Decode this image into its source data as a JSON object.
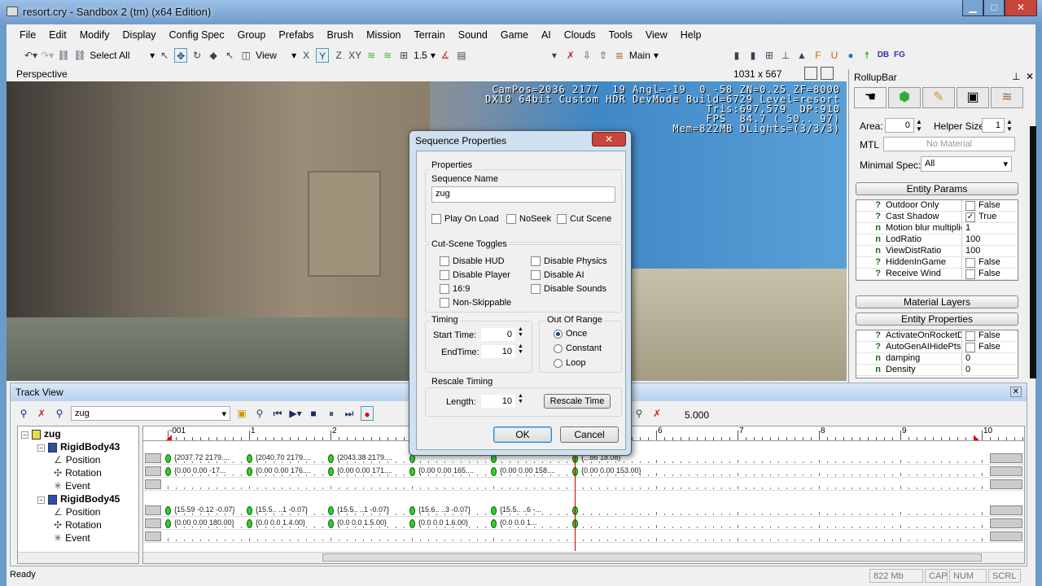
{
  "window": {
    "title": "resort.cry - Sandbox 2 (tm) (x64 Edition)",
    "min": "▁",
    "max": "□",
    "close": "✕"
  },
  "menu": [
    "File",
    "Edit",
    "Modify",
    "Display",
    "Config Spec",
    "Group",
    "Prefabs",
    "Brush",
    "Mission",
    "Terrain",
    "Sound",
    "Game",
    "AI",
    "Clouds",
    "Tools",
    "View",
    "Help"
  ],
  "toolbar": {
    "select_all": "Select All",
    "view": "View",
    "axes": [
      "X",
      "Y",
      "Z",
      "XY"
    ],
    "snap": "1.5",
    "layer": "Main",
    "db": "DB",
    "fg": "FG"
  },
  "viewport": {
    "label": "Perspective",
    "size": "1031 x 567",
    "hud": [
      "CamPos=2036 2177  19 Angl=-19  0 -58 ZN=0.25 ZF=8000",
      "DX10 64bit Custom HDR DevMode Build=6729 Level=resort",
      "Tris:697,579  DP:910",
      "FPS  84.7 ( 50.. 97)",
      "Mem=822MB DLights=(3/3/3)"
    ]
  },
  "rollup": {
    "title": "RollupBar",
    "area_label": "Area:",
    "area": "0",
    "helper_label": "Helper Size:",
    "helper": "1",
    "mtl_label": "MTL",
    "mtl": "No Material",
    "minspec_label": "Minimal Spec:",
    "minspec": "All",
    "entity_params": "Entity Params",
    "params": [
      {
        "t": "?",
        "n": "Outdoor Only",
        "v": "False",
        "c": false
      },
      {
        "t": "?",
        "n": "Cast Shadow",
        "v": "True",
        "c": true
      },
      {
        "t": "n",
        "n": "Motion blur multiplie",
        "v": "1"
      },
      {
        "t": "n",
        "n": "LodRatio",
        "v": "100"
      },
      {
        "t": "n",
        "n": "ViewDistRatio",
        "v": "100"
      },
      {
        "t": "?",
        "n": "HiddenInGame",
        "v": "False",
        "c": false
      },
      {
        "t": "?",
        "n": "Receive Wind",
        "v": "False",
        "c": false
      }
    ],
    "material_layers": "Material Layers",
    "entity_properties": "Entity Properties",
    "props": [
      {
        "t": "?",
        "n": "ActivateOnRocketD",
        "v": "False",
        "c": false
      },
      {
        "t": "?",
        "n": "AutoGenAIHidePts",
        "v": "False",
        "c": false
      },
      {
        "t": "n",
        "n": "damping",
        "v": "0"
      },
      {
        "t": "n",
        "n": "Density",
        "v": "0"
      }
    ]
  },
  "track": {
    "title": "Track View",
    "sequence": "zug",
    "time": "5.000",
    "current_time": 5,
    "tree": [
      {
        "label": "zug",
        "lvl": 0,
        "bold": true
      },
      {
        "label": "RigidBody43",
        "lvl": 1,
        "bold": true
      },
      {
        "label": "Position",
        "lvl": 2
      },
      {
        "label": "Rotation",
        "lvl": 2
      },
      {
        "label": "Event",
        "lvl": 2
      },
      {
        "label": "RigidBody45",
        "lvl": 1,
        "bold": true
      },
      {
        "label": "Position",
        "lvl": 2
      },
      {
        "label": "Rotation",
        "lvl": 2
      },
      {
        "label": "Event",
        "lvl": 2
      }
    ],
    "ruler": [
      "-001",
      "1",
      "2",
      "3",
      "4",
      "5",
      "6",
      "7",
      "8",
      "9",
      "10"
    ],
    "rows": [
      {
        "keys": [
          0,
          1,
          2,
          3,
          4,
          5
        ],
        "labels": [
          "{2037.72  2179....",
          "{2040.70  2179....",
          "{2043.38  2179....",
          "",
          "",
          "{...86  18.08}"
        ]
      },
      {
        "keys": [
          0,
          1,
          2,
          3,
          4,
          5
        ],
        "labels": [
          "{0.00  0.00  -17...",
          "{0.00  0.00  176....",
          "{0.00  0.00  171....",
          "{0.00  0.00  165....",
          "{0.00  0.00  158....",
          "{0.00  0.00  153.00}"
        ]
      },
      {
        "keys": [],
        "labels": []
      },
      null,
      {
        "keys": [
          0,
          1,
          2,
          3,
          4,
          5
        ],
        "labels": [
          "{15.59  -0.12  -0.07}",
          "{15.5.. ..1  -0.07}",
          "{15.5.. ..1  -0.07}",
          "{15.6.. ..3  -0.07}",
          "{15.5..  ..6  -...",
          ""
        ]
      },
      {
        "keys": [
          0,
          1,
          2,
          3,
          4,
          5
        ],
        "labels": [
          "{0.00  0.00  180.00}",
          "{0.0  0.0  1.4.00}",
          "{0.0  0.0  1.5.00}",
          "{0.0  0.0  1.6.00}",
          "{0.0  0.0  1...",
          ""
        ]
      },
      {
        "keys": [],
        "labels": []
      }
    ]
  },
  "dialog": {
    "title": "Sequence Properties",
    "properties": "Properties",
    "name_label": "Sequence Name",
    "name": "zug",
    "flags": [
      {
        "label": "Play On Load",
        "checked": false
      },
      {
        "label": "NoSeek",
        "checked": false
      },
      {
        "label": "Cut Scene",
        "checked": false
      }
    ],
    "toggles_label": "Cut-Scene Toggles",
    "toggles": [
      "Disable HUD",
      "Disable Physics",
      "Disable Player",
      "Disable AI",
      "16:9",
      "Disable Sounds",
      "Non-Skippable"
    ],
    "timing": "Timing",
    "start_label": "Start Time:",
    "start": "0",
    "end_label": "EndTime:",
    "end": "10",
    "range": "Out Of Range",
    "range_opts": [
      "Once",
      "Constant",
      "Loop"
    ],
    "range_selected": "Once",
    "rescale": "Rescale Timing",
    "length_label": "Length:",
    "length": "10",
    "rescale_btn": "Rescale Time",
    "ok": "OK",
    "cancel": "Cancel"
  },
  "status": {
    "text": "Ready",
    "mem": "822 Mb",
    "cap": "CAP",
    "num": "NUM",
    "scrl": "SCRL"
  }
}
